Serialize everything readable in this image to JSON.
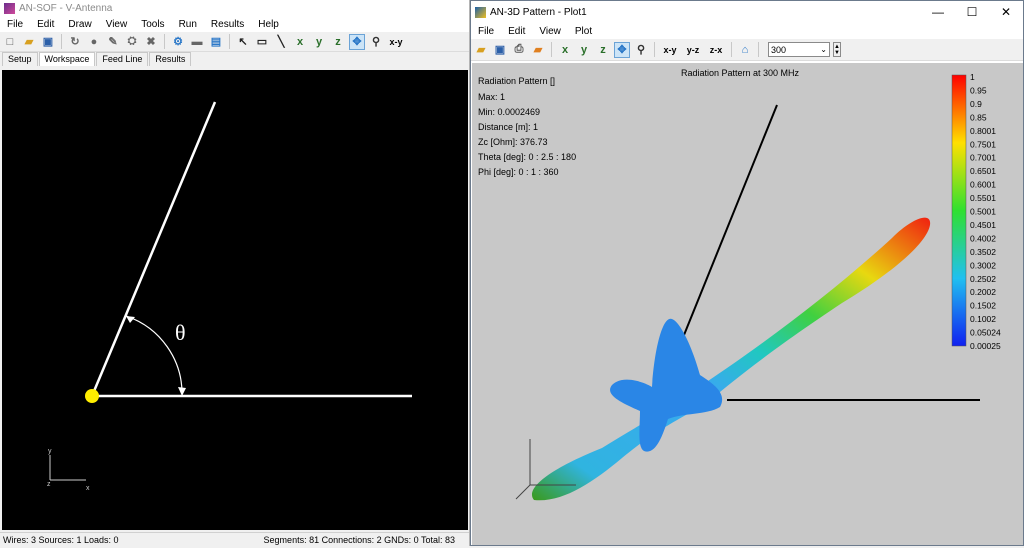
{
  "left_window": {
    "title": "AN-SOF - V-Antenna",
    "menu": [
      "File",
      "Edit",
      "Draw",
      "View",
      "Tools",
      "Run",
      "Results",
      "Help"
    ],
    "toolbar_axes": [
      "x",
      "y",
      "z"
    ],
    "toolbar_view_label": "x-y",
    "tabs": [
      "Setup",
      "Workspace",
      "Feed Line",
      "Results"
    ],
    "selected_tab": "Workspace",
    "angle_label": "θ",
    "axis_labels": {
      "x": "x",
      "y": "y",
      "z": "z"
    },
    "status_left": "Wires: 3  Sources: 1  Loads: 0",
    "status_right": "Segments: 81  Connections: 2  GNDs: 0  Total: 83"
  },
  "right_window": {
    "title": "AN-3D Pattern - Plot1",
    "menu": [
      "File",
      "Edit",
      "View",
      "Plot"
    ],
    "toolbar_views": [
      "x-y",
      "y-z",
      "z-x"
    ],
    "frequency_value": "300",
    "plot_title": "Radiation Pattern at 300 MHz",
    "info": [
      "Radiation Pattern []",
      "Max: 1",
      "Min: 0.0002469",
      "Distance [m]: 1",
      "Zc [Ohm]: 376.73",
      "Theta [deg]: 0 : 2.5 : 180",
      "Phi [deg]: 0 : 1 : 360"
    ],
    "colorbar_labels": [
      "1",
      "0.95",
      "0.9",
      "0.85",
      "0.8001",
      "0.7501",
      "0.7001",
      "0.6501",
      "0.6001",
      "0.5501",
      "0.5001",
      "0.4501",
      "0.4002",
      "0.3502",
      "0.3002",
      "0.2502",
      "0.2002",
      "0.1502",
      "0.1002",
      "0.05024",
      "0.00025"
    ]
  },
  "colors": {
    "workspace_bg": "#000000",
    "wire": "#ffffff",
    "source": "#ffee00",
    "plot_bg": "#c8c8c8"
  }
}
